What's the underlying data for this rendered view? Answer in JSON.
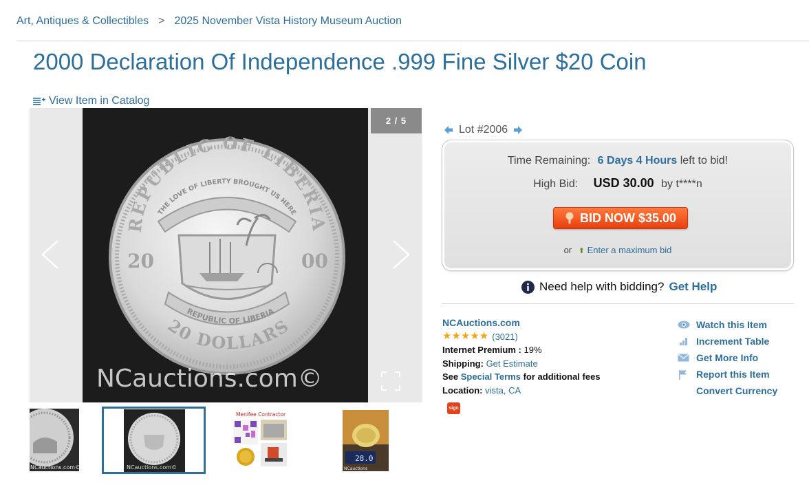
{
  "breadcrumb": {
    "items": [
      "Art, Antiques & Collectibles",
      "2025 November Vista History Museum Auction"
    ],
    "separator": ">"
  },
  "item": {
    "title": "2000 Declaration Of Independence .999 Fine Silver $20 Coin",
    "view_catalog": "View Item in Catalog"
  },
  "gallery": {
    "counter": "2 / 5",
    "watermark": "NCauctions.com©",
    "coin_top_text": "REPUBLIC OF LIBERIA",
    "coin_ribbon_text": "THE LOVE OF LIBERTY BROUGHT US HERE",
    "coin_year_left": "20",
    "coin_year_right": "00",
    "coin_bottom_ribbon": "REPUBLIC OF LIBERIA",
    "coin_value": "20 DOLLARS",
    "thumbs": [
      {
        "caption": "NCauctions.com©"
      },
      {
        "caption": "NCauctions.com©"
      },
      {
        "caption": "Menifee Contractor"
      },
      {
        "caption": "NCauctions",
        "scale_reading": "28.0"
      }
    ]
  },
  "lot": {
    "label": "Lot #2006"
  },
  "bidding": {
    "time_label": "Time Remaining:",
    "time_value": "6 Days 4 Hours",
    "time_suffix": "left to bid!",
    "high_label": "High Bid:",
    "high_amount": "USD 30.00",
    "high_by": "by t****n",
    "bid_button": "BID NOW $35.00",
    "or_text": "or",
    "max_bid": "Enter a maximum bid"
  },
  "help": {
    "text": "Need help with bidding?",
    "link": "Get Help"
  },
  "seller": {
    "name": "NCAuctions.com",
    "rating_stars": 5,
    "rating_count": "(3021)",
    "premium_label": "Internet Premium :",
    "premium_value": "19%",
    "shipping_label": "Shipping:",
    "shipping_value": "Get Estimate",
    "see_text": "See",
    "special_terms": "Special Terms",
    "fees_text": "for additional fees",
    "location_label": "Location:",
    "location_value": "vista, CA",
    "badge": "sign"
  },
  "actions": [
    {
      "label": "Watch this Item",
      "icon": "eye-icon"
    },
    {
      "label": "Increment Table",
      "icon": "bar-chart-icon"
    },
    {
      "label": "Get More Info",
      "icon": "envelope-icon"
    },
    {
      "label": "Report this Item",
      "icon": "flag-icon"
    },
    {
      "label": "Convert Currency",
      "icon": ""
    }
  ],
  "colors": {
    "link": "#2c6e9c",
    "bid_button": "#f05a1e",
    "star": "#f0a818"
  }
}
